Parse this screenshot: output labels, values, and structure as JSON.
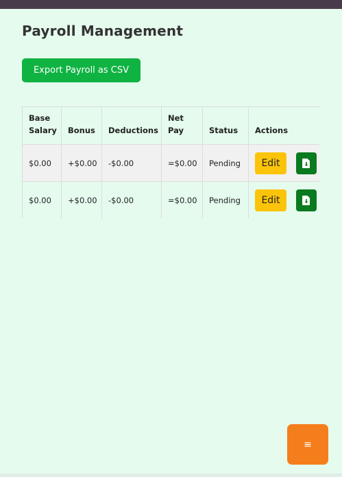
{
  "page": {
    "title": "Payroll Management"
  },
  "toolbar": {
    "export_label": "Export Payroll as CSV"
  },
  "table": {
    "headers": [
      "Base Salary",
      "Bonus",
      "Deductions",
      "Net Pay",
      "Status",
      "Actions"
    ],
    "rows": [
      {
        "base": "$0.00",
        "bonus": "+$0.00",
        "deductions": "-$0.00",
        "net": "=$0.00",
        "status": "Pending",
        "edit_label": "Edit"
      },
      {
        "base": "$0.00",
        "bonus": "+$0.00",
        "deductions": "-$0.00",
        "net": "=$0.00",
        "status": "Pending",
        "edit_label": "Edit"
      }
    ]
  },
  "menu_fab": {
    "icon": "hamburger-menu-icon",
    "glyph": "≡"
  },
  "colors": {
    "page_bg": "#e5fbee",
    "export_btn": "#0fb342",
    "edit_btn": "#fbc40a",
    "download_btn": "#0a7a1e",
    "fab": "#f57e1c",
    "topbar": "#4a3b4a"
  },
  "icons": {
    "download": "file-download-icon"
  }
}
